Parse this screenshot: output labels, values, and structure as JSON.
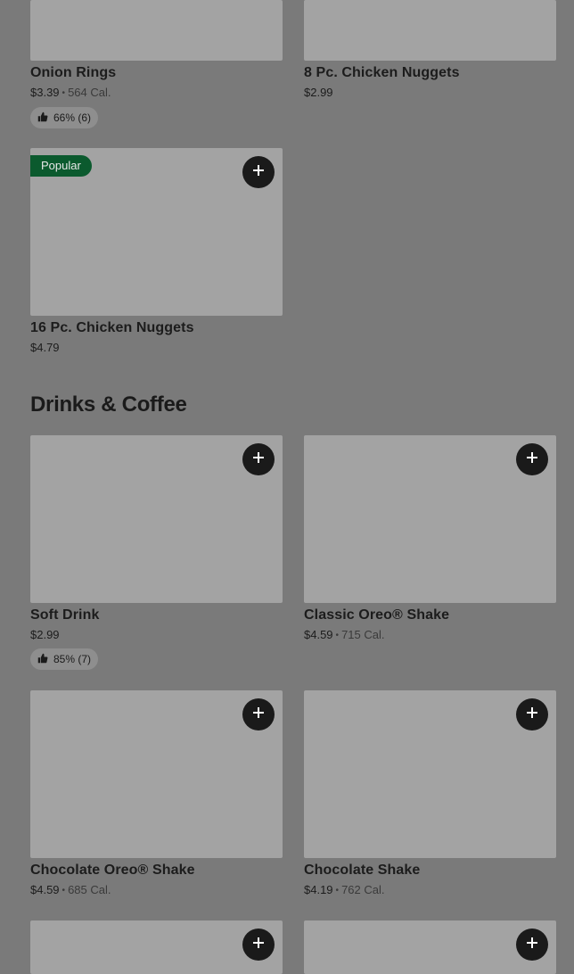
{
  "sections": {
    "sides_top": {
      "items": [
        {
          "name": "Onion Rings",
          "price": "$3.39",
          "calories": "564 Cal.",
          "rating": "66% (6)"
        },
        {
          "name": "8 Pc. Chicken Nuggets",
          "price": "$2.99"
        },
        {
          "name": "16 Pc. Chicken Nuggets",
          "price": "$4.79",
          "badge": "Popular"
        }
      ]
    },
    "drinks": {
      "title": "Drinks & Coffee",
      "items": [
        {
          "name": "Soft Drink",
          "price": "$2.99",
          "rating": "85% (7)"
        },
        {
          "name": "Classic Oreo® Shake",
          "price": "$4.59",
          "calories": "715 Cal."
        },
        {
          "name": "Chocolate Oreo® Shake",
          "price": "$4.59",
          "calories": "685 Cal."
        },
        {
          "name": "Chocolate Shake",
          "price": "$4.19",
          "calories": "762 Cal."
        }
      ]
    }
  },
  "icons": {
    "add": "plus-icon",
    "rating": "thumbs-up-icon"
  },
  "colors": {
    "popular_badge": "#0b5a2e",
    "add_button": "#1a1a1a"
  }
}
